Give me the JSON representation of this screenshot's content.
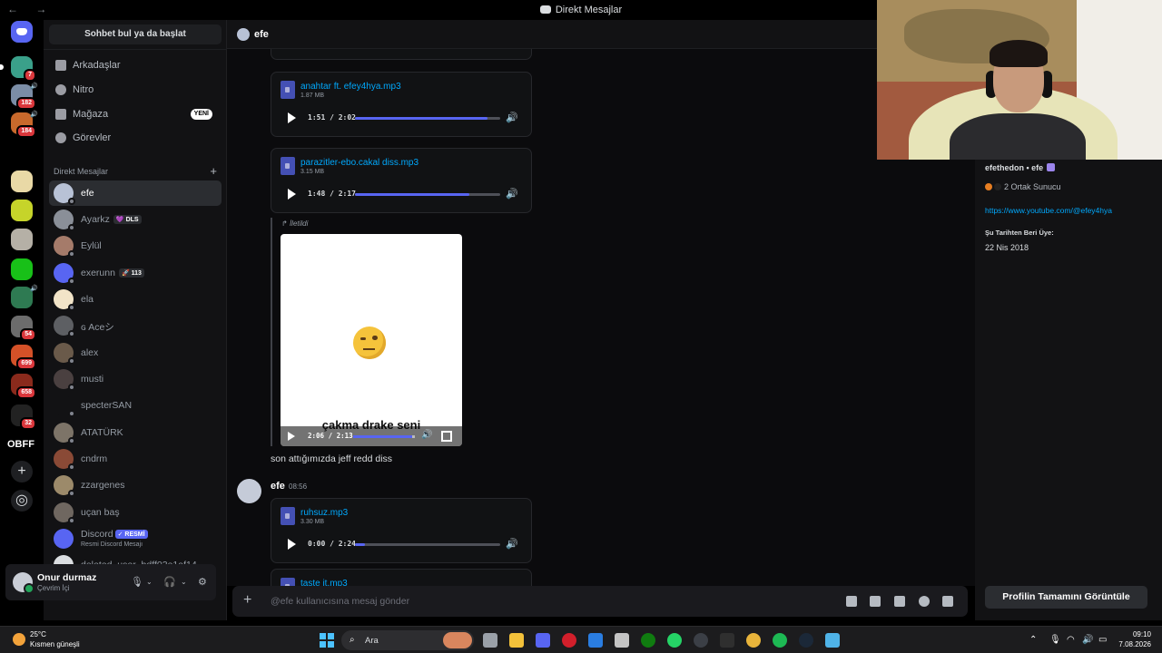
{
  "window": {
    "title": "Direkt Mesajlar"
  },
  "rail": {
    "badges": [
      "7",
      "182",
      "184",
      "54",
      "699",
      "658",
      "32"
    ],
    "label_obff": "OBFF"
  },
  "sidebar": {
    "search": "Sohbet bul ya da başlat",
    "nav": [
      {
        "label": "Arkadaşlar"
      },
      {
        "label": "Nitro"
      },
      {
        "label": "Mağaza",
        "badge": "YENİ"
      },
      {
        "label": "Görevler"
      }
    ],
    "dm_header": "Direkt Mesajlar",
    "dms": [
      {
        "name": "efe"
      },
      {
        "name": "Ayarkz",
        "tag": "💜 DLS"
      },
      {
        "name": "Eylül"
      },
      {
        "name": "exerunn",
        "tag": "🚀 113"
      },
      {
        "name": "ela"
      },
      {
        "name": "ɢ Aceシ"
      },
      {
        "name": "alex"
      },
      {
        "name": "musti"
      },
      {
        "name": "specterSAN"
      },
      {
        "name": "ATATÜRK"
      },
      {
        "name": "cndrm"
      },
      {
        "name": "zzargenes"
      },
      {
        "name": "uçan baş"
      },
      {
        "name": "Discord",
        "tag": "✓ RESMİ",
        "sub": "Resmi Discord Mesajı"
      },
      {
        "name": "deleted_user_bdff03e1af14"
      }
    ]
  },
  "user": {
    "name": "Onur durmaz",
    "status": "Çevrim İçi"
  },
  "header": {
    "name": "efe"
  },
  "messages": {
    "attachments": [
      {
        "name": "anahtar ft. efey4hya.mp3",
        "size": "1.87 MB",
        "time": "1:51 / 2:02",
        "progress": 0.91
      },
      {
        "name": "parazitler-ebo.cakal diss.mp3",
        "size": "3.15 MB",
        "time": "1:48 / 2:17",
        "progress": 0.79
      }
    ],
    "forwarded_label": "İletildi",
    "video": {
      "caption": "çakma drake seni",
      "time": "2:06 / 2:13",
      "progress": 0.95
    },
    "text": "son attığımızda jeff redd diss",
    "author": "efe",
    "timestamp": "08:56",
    "attachment3": {
      "name": "ruhsuz.mp3",
      "size": "3.30 MB",
      "time": "0:00 / 2:24",
      "progress": 0.07
    },
    "attachment4_partial": "taste it.mp3"
  },
  "composer": {
    "placeholder": "@efe kullanıcısına mesaj gönder"
  },
  "profile": {
    "username": "efethedon",
    "display": "efe",
    "mutual": "2 Ortak Sunucu",
    "link": "https://www.youtube.com/@efey4hya",
    "since_label": "Şu Tarihten Beri Üye:",
    "since_date": "22 Nis 2018",
    "button": "Profilin Tamamını Görüntüle"
  },
  "taskbar": {
    "temp": "25°C",
    "weather": "Kısmen güneşli",
    "search": "Ara",
    "time": "09:10",
    "date": "7.08.2026"
  },
  "colors": {
    "accent": "#5865f2",
    "link": "#00a8fc",
    "bg": "#0b0b0d",
    "sidebar": "#121214"
  }
}
